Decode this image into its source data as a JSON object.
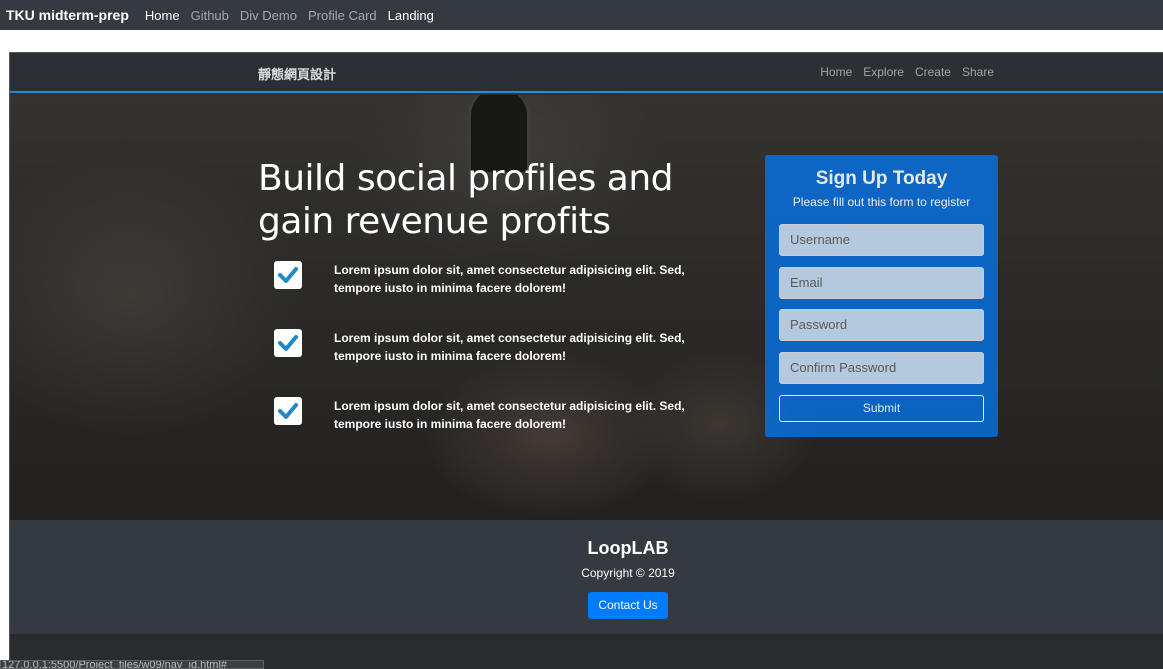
{
  "outer_nav": {
    "brand": "TKU midterm-prep",
    "links": [
      "Home",
      "Github",
      "Div Demo",
      "Profile Card",
      "Landing"
    ]
  },
  "inner_nav": {
    "brand": "靜態網頁設計",
    "links": [
      "Home",
      "Explore",
      "Create",
      "Share"
    ]
  },
  "hero": {
    "headline": "Build social profiles and gain revenue profits",
    "features": [
      "Lorem ipsum dolor sit, amet consectetur adipisicing elit. Sed, tempore iusto in minima facere dolorem!",
      "Lorem ipsum dolor sit, amet consectetur adipisicing elit. Sed, tempore iusto in minima facere dolorem!",
      "Lorem ipsum dolor sit, amet consectetur adipisicing elit. Sed, tempore iusto in minima facere dolorem!"
    ]
  },
  "signup": {
    "title": "Sign Up Today",
    "subtitle": "Please fill out this form to register",
    "placeholders": [
      "Username",
      "Email",
      "Password",
      "Confirm Password"
    ],
    "submit": "Submit"
  },
  "footer": {
    "brand": "LoopLAB",
    "copyright": "Copyright © 2019",
    "contact": "Contact Us"
  },
  "status_url": "127.0.0.1:5500/Project_files/w09/nav_id.html#",
  "colors": {
    "primary": "#007bff",
    "check": "#1e88c8",
    "dark": "#343a40"
  }
}
